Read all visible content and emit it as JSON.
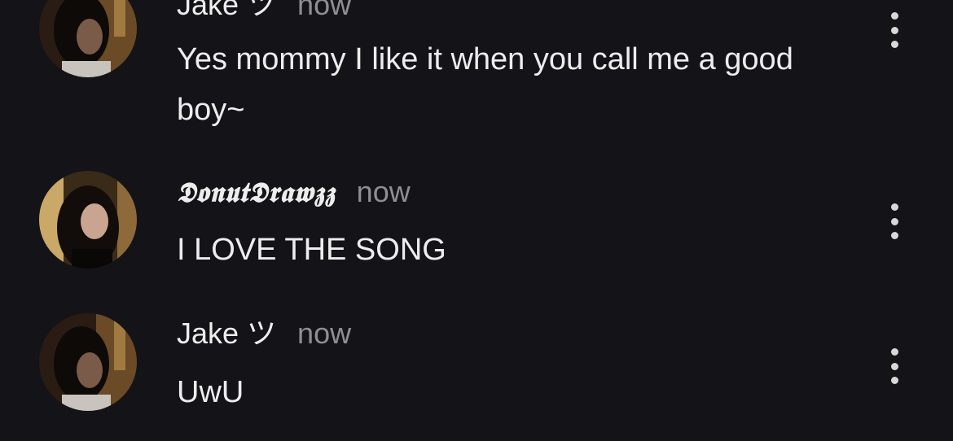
{
  "comments": [
    {
      "username": "Jake ツ",
      "timestamp": "now",
      "message": "Yes mommy I like it when you call me a good boy~",
      "avatar_icon": "avatar-dark-hair-icon",
      "more_icon": "more-vertical-icon"
    },
    {
      "username": "𝕯𝖔𝖓𝖚𝖙𝕯𝖗𝖆𝖜𝖟𝖟",
      "timestamp": "now",
      "message": "I LOVE THE SONG",
      "avatar_icon": "avatar-woman-icon",
      "more_icon": "more-vertical-icon"
    },
    {
      "username": "Jake ツ",
      "timestamp": "now",
      "message": "UwU",
      "avatar_icon": "avatar-dark-hair-icon",
      "more_icon": "more-vertical-icon"
    }
  ],
  "colors": {
    "background": "#141418",
    "text": "#ededed",
    "muted": "#8e8e93",
    "icon": "#d8d8d8"
  }
}
